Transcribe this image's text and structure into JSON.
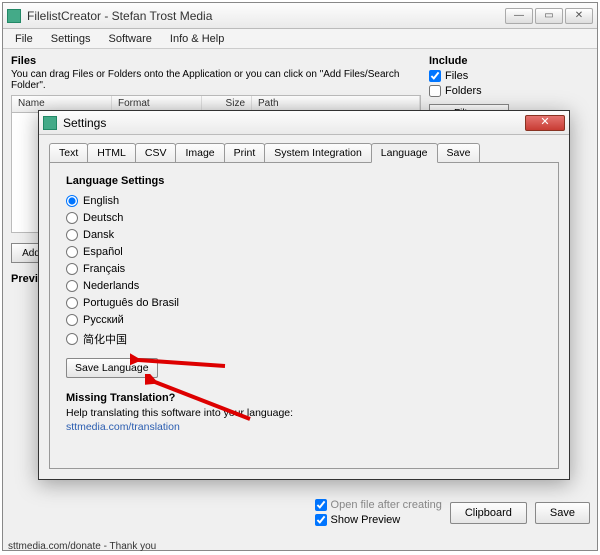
{
  "main": {
    "title": "FilelistCreator - Stefan Trost Media",
    "menu": [
      "File",
      "Settings",
      "Software",
      "Info & Help"
    ],
    "files": {
      "title": "Files",
      "help": "You can drag Files or Folders onto the Application or you can click on \"Add Files/Search Folder\".",
      "cols": {
        "name": "Name",
        "format": "Format",
        "size": "Size",
        "path": "Path"
      },
      "add_label": "Add"
    },
    "preview_title": "Previ",
    "include": {
      "title": "Include",
      "files_label": "Files",
      "files_checked": true,
      "folders_label": "Folders",
      "folders_checked": false,
      "filter_label": "Filter..."
    },
    "bottom": {
      "open_label": "Open file after creating",
      "open_checked": true,
      "show_preview_label": "Show Preview",
      "show_preview_checked": true,
      "clipboard": "Clipboard",
      "save": "Save"
    },
    "footer": "sttmedia.com/donate - Thank you"
  },
  "dialog": {
    "title": "Settings",
    "tabs": [
      "Text",
      "HTML",
      "CSV",
      "Image",
      "Print",
      "System Integration",
      "Language",
      "Save"
    ],
    "active_tab": "Language",
    "lang": {
      "heading": "Language Settings",
      "options": [
        "English",
        "Deutsch",
        "Dansk",
        "Español",
        "Français",
        "Nederlands",
        "Português do Brasil",
        "Русский",
        "简化中国"
      ],
      "selected": "English",
      "save_label": "Save Language",
      "missing_title": "Missing Translation?",
      "missing_text": "Help translating this software into your language:",
      "missing_link": "sttmedia.com/translation"
    }
  }
}
